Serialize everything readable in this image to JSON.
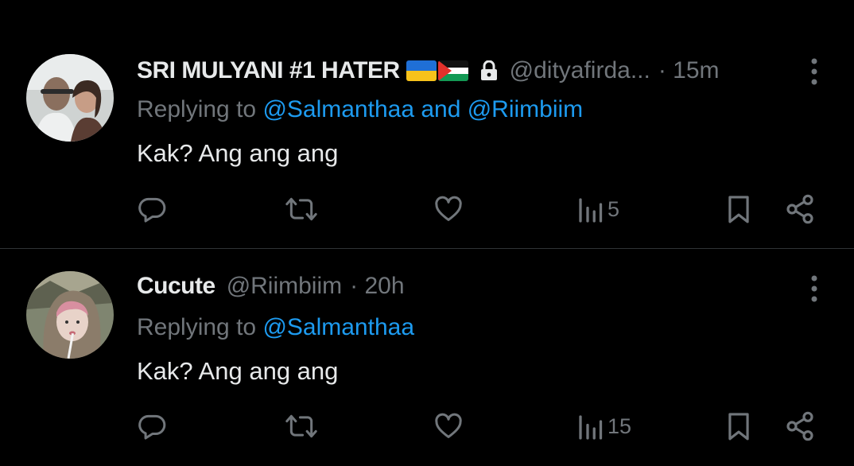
{
  "colors": {
    "background": "#000000",
    "text_primary": "#e7e9ea",
    "text_secondary": "#71767b",
    "link": "#1d9bf0",
    "divider": "#2f3336"
  },
  "tweets": [
    {
      "display_name": "SRI MULYANI #1 HATER",
      "badges": [
        "ukraine-flag",
        "palestine-flag",
        "lock-icon"
      ],
      "handle": "@dityafirda...",
      "time": "· 15m",
      "replying_prefix": "Replying to",
      "replying_to": "@Salmanthaa and @Riimbiim",
      "text": "Kak? Ang ang ang",
      "actions": {
        "reply": "",
        "retweet": "",
        "like": "",
        "views": "5",
        "bookmark": "",
        "share": ""
      }
    },
    {
      "display_name": "Cucute",
      "badges": [],
      "handle": "@Riimbiim",
      "time": "· 20h",
      "replying_prefix": "Replying to",
      "replying_to": "@Salmanthaa",
      "text": "Kak? Ang ang ang",
      "actions": {
        "reply": "",
        "retweet": "",
        "like": "",
        "views": "15",
        "bookmark": "",
        "share": ""
      }
    }
  ]
}
